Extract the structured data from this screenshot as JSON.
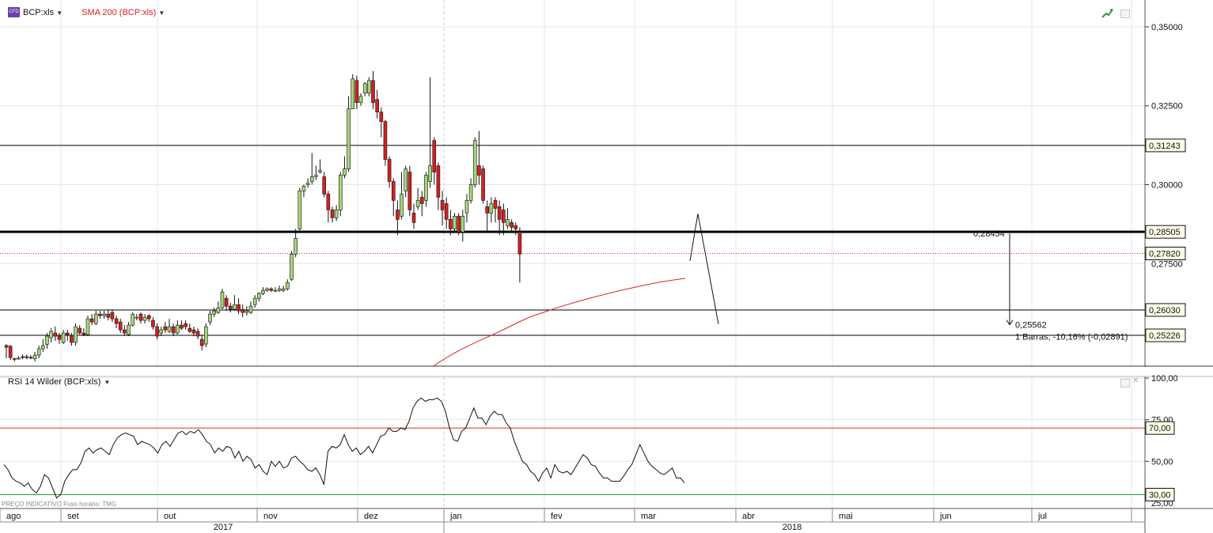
{
  "header": {
    "instrument_label": "BCP:xls",
    "badge_text": "CFD",
    "overlay_label": "SMA 200 (BCP:xls)",
    "overlay_color": "#dd2222"
  },
  "rsi_panel": {
    "label": "RSI 14 Wilder (BCP:xls)",
    "footer_note": "PREÇO INDICATIVO   Fuso horário: TMG"
  },
  "icons": {
    "chart_type": "trend-up-icon",
    "window": "restore-icon",
    "close": "close-icon"
  },
  "colors": {
    "up_candle": "#a4d67a",
    "down_candle": "#d42020",
    "sma": "#dd2222",
    "rsi_line": "#111111",
    "rsi_high": "#cc3333",
    "rsi_low": "#2a9a3a",
    "grid": "#e6e6e6"
  },
  "chart_data": {
    "type": "candlestick",
    "price_axis": {
      "ylim": [
        0.2425,
        0.3585
      ],
      "ticks": [
        "0,35000",
        "0,32500",
        "0,30000"
      ],
      "partial_tick": "0,27500"
    },
    "time_axis": {
      "months": [
        "ago",
        "set",
        "out",
        "nov",
        "dez",
        "jan",
        "fev",
        "mar",
        "abr",
        "mai",
        "jun",
        "jul"
      ],
      "years": [
        "2017",
        "2018"
      ]
    },
    "horizontal_lines": [
      {
        "value": 0.31243,
        "label": "0,31243",
        "style": "thin"
      },
      {
        "value": 0.28505,
        "label": "0,28505",
        "style": "thick"
      },
      {
        "value": 0.2782,
        "label": "0,27820",
        "style": "dotted"
      },
      {
        "value": 0.2603,
        "label": "0,26030",
        "style": "thin"
      },
      {
        "value": 0.25226,
        "label": "0,25226",
        "style": "thin"
      }
    ],
    "measure_tool": {
      "start_value": 0.28454,
      "start_label": "0,28454",
      "end_value": 0.25562,
      "end_label": "0,25562",
      "summary": "1 Barras, -10,16% (-0,02891)"
    },
    "projection_path": [
      [
        0.2758,
        0.2908
      ],
      [
        0.2908,
        0.2558
      ]
    ],
    "candles": [
      [
        0.249,
        0.2485,
        0.2495,
        0.245
      ],
      [
        0.2488,
        0.2452,
        0.2492,
        0.2445
      ],
      [
        0.2449,
        0.2448,
        0.2451,
        0.244
      ],
      [
        0.245,
        0.245,
        0.2456,
        0.2446
      ],
      [
        0.2455,
        0.2452,
        0.2462,
        0.2447
      ],
      [
        0.2455,
        0.2452,
        0.2462,
        0.2447
      ],
      [
        0.2453,
        0.2452,
        0.246,
        0.2447
      ],
      [
        0.2448,
        0.246,
        0.247,
        0.244
      ],
      [
        0.246,
        0.248,
        0.249,
        0.245
      ],
      [
        0.248,
        0.249,
        0.251,
        0.247
      ],
      [
        0.2494,
        0.252,
        0.253,
        0.248
      ],
      [
        0.2515,
        0.2535,
        0.2545,
        0.25
      ],
      [
        0.253,
        0.252,
        0.255,
        0.2505
      ],
      [
        0.252,
        0.251,
        0.253,
        0.2495
      ],
      [
        0.25,
        0.253,
        0.254,
        0.2495
      ],
      [
        0.253,
        0.2525,
        0.254,
        0.2505
      ],
      [
        0.252,
        0.25,
        0.253,
        0.249
      ],
      [
        0.25,
        0.255,
        0.256,
        0.249
      ],
      [
        0.2545,
        0.253,
        0.2555,
        0.2525
      ],
      [
        0.253,
        0.2525,
        0.2545,
        0.252
      ],
      [
        0.2525,
        0.2575,
        0.2585,
        0.252
      ],
      [
        0.2575,
        0.2565,
        0.259,
        0.2555
      ],
      [
        0.256,
        0.259,
        0.26,
        0.2555
      ],
      [
        0.259,
        0.2585,
        0.26,
        0.2575
      ],
      [
        0.2585,
        0.259,
        0.26,
        0.2575
      ],
      [
        0.259,
        0.258,
        0.2605,
        0.257
      ],
      [
        0.2595,
        0.2575,
        0.2605,
        0.2565
      ],
      [
        0.2575,
        0.256,
        0.2585,
        0.2545
      ],
      [
        0.2565,
        0.254,
        0.2575,
        0.253
      ],
      [
        0.254,
        0.253,
        0.2555,
        0.252
      ],
      [
        0.2525,
        0.2555,
        0.2565,
        0.252
      ],
      [
        0.2555,
        0.259,
        0.2595,
        0.255
      ],
      [
        0.258,
        0.258,
        0.259,
        0.257
      ],
      [
        0.259,
        0.257,
        0.2595,
        0.256
      ],
      [
        0.257,
        0.258,
        0.259,
        0.256
      ],
      [
        0.2585,
        0.2575,
        0.259,
        0.2565
      ],
      [
        0.257,
        0.255,
        0.258,
        0.254
      ],
      [
        0.255,
        0.252,
        0.256,
        0.251
      ],
      [
        0.253,
        0.254,
        0.255,
        0.252
      ],
      [
        0.255,
        0.254,
        0.2565,
        0.253
      ],
      [
        0.2535,
        0.255,
        0.2575,
        0.253
      ],
      [
        0.255,
        0.253,
        0.256,
        0.252
      ],
      [
        0.253,
        0.2555,
        0.257,
        0.2525
      ],
      [
        0.2555,
        0.2545,
        0.257,
        0.254
      ],
      [
        0.256,
        0.255,
        0.257,
        0.254
      ],
      [
        0.2545,
        0.2535,
        0.256,
        0.253
      ],
      [
        0.254,
        0.253,
        0.255,
        0.252
      ],
      [
        0.2535,
        0.252,
        0.2545,
        0.251
      ],
      [
        0.251,
        0.249,
        0.2525,
        0.2475
      ],
      [
        0.2495,
        0.255,
        0.256,
        0.2485
      ],
      [
        0.2565,
        0.259,
        0.26,
        0.2555
      ],
      [
        0.259,
        0.26,
        0.261,
        0.258
      ],
      [
        0.2595,
        0.261,
        0.263,
        0.259
      ],
      [
        0.261,
        0.266,
        0.267,
        0.2605
      ],
      [
        0.264,
        0.2615,
        0.265,
        0.26
      ],
      [
        0.2615,
        0.2605,
        0.2625,
        0.2595
      ],
      [
        0.2605,
        0.262,
        0.265,
        0.26
      ],
      [
        0.262,
        0.26,
        0.264,
        0.259
      ],
      [
        0.2605,
        0.2595,
        0.262,
        0.258
      ],
      [
        0.2595,
        0.26,
        0.2615,
        0.2585
      ],
      [
        0.2595,
        0.2615,
        0.263,
        0.259
      ],
      [
        0.262,
        0.264,
        0.265,
        0.261
      ],
      [
        0.264,
        0.2655,
        0.266,
        0.263
      ],
      [
        0.2655,
        0.2665,
        0.2675,
        0.265
      ],
      [
        0.2665,
        0.267,
        0.2675,
        0.266
      ],
      [
        0.267,
        0.2665,
        0.2675,
        0.266
      ],
      [
        0.2665,
        0.2665,
        0.2675,
        0.266
      ],
      [
        0.2665,
        0.267,
        0.268,
        0.266
      ],
      [
        0.2665,
        0.267,
        0.268,
        0.266
      ],
      [
        0.267,
        0.269,
        0.27,
        0.2665
      ],
      [
        0.27,
        0.278,
        0.279,
        0.2695
      ],
      [
        0.278,
        0.283,
        0.286,
        0.277
      ],
      [
        0.286,
        0.298,
        0.299,
        0.285
      ],
      [
        0.298,
        0.2995,
        0.3,
        0.296
      ],
      [
        0.3,
        0.3005,
        0.302,
        0.299
      ],
      [
        0.301,
        0.3025,
        0.31,
        0.3
      ],
      [
        0.3025,
        0.303,
        0.306,
        0.3015
      ],
      [
        0.304,
        0.3045,
        0.308,
        0.3035
      ],
      [
        0.3025,
        0.297,
        0.304,
        0.296
      ],
      [
        0.297,
        0.292,
        0.298,
        0.288
      ],
      [
        0.292,
        0.2895,
        0.293,
        0.288
      ],
      [
        0.2895,
        0.292,
        0.2935,
        0.2885
      ],
      [
        0.292,
        0.303,
        0.304,
        0.29
      ],
      [
        0.303,
        0.305,
        0.309,
        0.302
      ],
      [
        0.305,
        0.324,
        0.328,
        0.304
      ],
      [
        0.324,
        0.3335,
        0.335,
        0.324
      ],
      [
        0.333,
        0.326,
        0.3345,
        0.324
      ],
      [
        0.326,
        0.328,
        0.329,
        0.325
      ],
      [
        0.329,
        0.332,
        0.3325,
        0.328
      ],
      [
        0.329,
        0.333,
        0.334,
        0.328
      ],
      [
        0.333,
        0.326,
        0.336,
        0.324
      ],
      [
        0.327,
        0.323,
        0.33,
        0.321
      ],
      [
        0.323,
        0.32,
        0.3245,
        0.315
      ],
      [
        0.32,
        0.308,
        0.3205,
        0.306
      ],
      [
        0.308,
        0.301,
        0.309,
        0.299
      ],
      [
        0.301,
        0.295,
        0.302,
        0.29
      ],
      [
        0.292,
        0.289,
        0.295,
        0.284
      ],
      [
        0.29,
        0.297,
        0.304,
        0.289
      ],
      [
        0.298,
        0.305,
        0.306,
        0.296
      ],
      [
        0.304,
        0.292,
        0.306,
        0.29
      ],
      [
        0.291,
        0.288,
        0.294,
        0.286
      ],
      [
        0.293,
        0.295,
        0.299,
        0.292
      ],
      [
        0.296,
        0.294,
        0.298,
        0.29
      ],
      [
        0.295,
        0.303,
        0.304,
        0.293
      ],
      [
        0.301,
        0.306,
        0.334,
        0.299
      ],
      [
        0.314,
        0.304,
        0.315,
        0.3
      ],
      [
        0.306,
        0.296,
        0.307,
        0.292
      ],
      [
        0.295,
        0.292,
        0.298,
        0.287
      ],
      [
        0.294,
        0.289,
        0.296,
        0.286
      ],
      [
        0.289,
        0.286,
        0.292,
        0.284
      ],
      [
        0.286,
        0.29,
        0.291,
        0.285
      ],
      [
        0.29,
        0.285,
        0.291,
        0.284
      ],
      [
        0.285,
        0.29,
        0.292,
        0.282
      ],
      [
        0.291,
        0.295,
        0.297,
        0.288
      ],
      [
        0.295,
        0.3,
        0.302,
        0.294
      ],
      [
        0.3,
        0.314,
        0.315,
        0.299
      ],
      [
        0.306,
        0.303,
        0.317,
        0.3
      ],
      [
        0.305,
        0.295,
        0.306,
        0.294
      ],
      [
        0.293,
        0.291,
        0.295,
        0.285
      ],
      [
        0.291,
        0.294,
        0.296,
        0.288
      ],
      [
        0.295,
        0.2925,
        0.296,
        0.288
      ],
      [
        0.293,
        0.289,
        0.295,
        0.284
      ],
      [
        0.292,
        0.288,
        0.294,
        0.284
      ],
      [
        0.287,
        0.289,
        0.2925,
        0.286
      ],
      [
        0.288,
        0.2865,
        0.289,
        0.285
      ],
      [
        0.287,
        0.286,
        0.288,
        0.284
      ],
      [
        0.285,
        0.278,
        0.2865,
        0.269
      ]
    ],
    "sma200": [
      [
        0.2425,
        0.2428
      ],
      [
        0.2502,
        0.2464
      ],
      [
        0.2559,
        0.2504
      ],
      [
        0.2575,
        0.2508
      ],
      [
        0.2634,
        0.2545
      ],
      [
        0.2687,
        0.258
      ]
    ],
    "rsi": {
      "ylim": [
        25,
        100
      ],
      "ticks": [
        "100,00",
        "75,00",
        "50,00"
      ],
      "partial_tick": "25,00",
      "levels": [
        {
          "value": 70,
          "label": "70,00"
        },
        {
          "value": 30,
          "label": "30,00"
        }
      ],
      "values": [
        48,
        45,
        40,
        38,
        37,
        35,
        37,
        33,
        31,
        35,
        42,
        40,
        34,
        28,
        30,
        38,
        42,
        45,
        45,
        49,
        56,
        58,
        55,
        57,
        58,
        56,
        54,
        60,
        64,
        66,
        67,
        66,
        65,
        60,
        62,
        61,
        60,
        58,
        55,
        60,
        62,
        59,
        63,
        67,
        68,
        66,
        68,
        67,
        69,
        66,
        62,
        60,
        55,
        58,
        56,
        59,
        58,
        52,
        56,
        50,
        53,
        51,
        46,
        48,
        44,
        42,
        50,
        47,
        50,
        46,
        47,
        52,
        53,
        50,
        48,
        45,
        44,
        46,
        42,
        36,
        56,
        59,
        58,
        60,
        66,
        60,
        56,
        58,
        54,
        56,
        59,
        55,
        60,
        65,
        66,
        70,
        68,
        68,
        70,
        69,
        74,
        82,
        86,
        88,
        86,
        87,
        87,
        88,
        86,
        80,
        70,
        63,
        62,
        68,
        70,
        76,
        82,
        76,
        76,
        72,
        77,
        80,
        78,
        78,
        73,
        70,
        62,
        56,
        50,
        48,
        44,
        42,
        38,
        43,
        46,
        40,
        48,
        44,
        43,
        44,
        42,
        46,
        50,
        54,
        52,
        48,
        47,
        43,
        40,
        40,
        38,
        38,
        38,
        41,
        45,
        48,
        54,
        60,
        55,
        50,
        47,
        45,
        43,
        42,
        44,
        46,
        40,
        40,
        37
      ]
    }
  }
}
